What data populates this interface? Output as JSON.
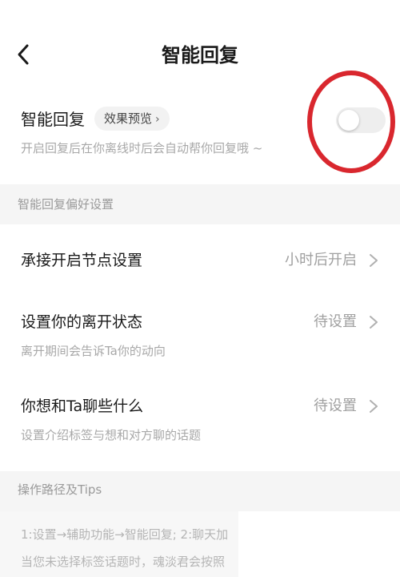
{
  "header": {
    "title": "智能回复",
    "back_icon": "chevron-left-icon"
  },
  "smart_reply": {
    "title": "智能回复",
    "preview_label": "效果预览",
    "preview_chevron": "›",
    "description": "开启回复后在你离线时后会自动帮你回复哦 ~",
    "toggle_on": false
  },
  "preferences": {
    "section_title": "智能回复偏好设置",
    "items": [
      {
        "title": "承接开启节点设置",
        "value": "小时后开启",
        "subtitle": ""
      },
      {
        "title": "设置你的离开状态",
        "value": "待设置",
        "subtitle": "离开期间会告诉Ta你的动向"
      },
      {
        "title": "你想和Ta聊些什么",
        "value": "待设置",
        "subtitle": "设置介绍标签与想和对方聊的话题"
      }
    ]
  },
  "tips": {
    "section_title": "操作路径及Tips",
    "lines": [
      "1:设置→辅助功能→智能回复; 2:聊天加",
      "当您未选择标签话题时，魂淡君会按照"
    ]
  },
  "colors": {
    "annotation": "#d9272e",
    "section_bg": "#f5f5f5"
  }
}
